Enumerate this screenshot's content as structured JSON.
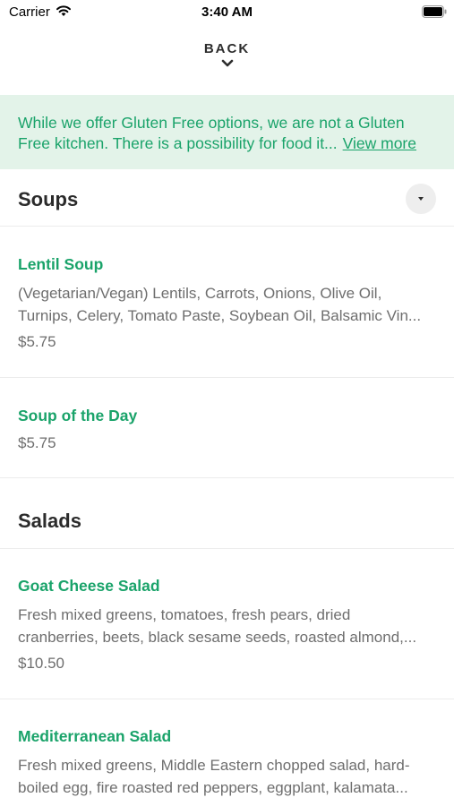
{
  "status_bar": {
    "carrier": "Carrier",
    "time": "3:40 AM"
  },
  "nav": {
    "back_label": "BACK"
  },
  "notice": {
    "text": "While we offer Gluten Free options, we are not a Gluten Free kitchen. There is a possibility for food it...",
    "link": "View more"
  },
  "sections": [
    {
      "title": "Soups",
      "items": [
        {
          "name": "Lentil Soup",
          "desc_line1": "(Vegetarian/Vegan)  Lentils, Carrots, Onions, Olive Oil,",
          "desc_line2": "Turnips, Celery, Tomato Paste, Soybean Oil, Balsamic Vin...",
          "price": "$5.75"
        },
        {
          "name": "Soup of the Day",
          "price": "$5.75"
        }
      ]
    },
    {
      "title": "Salads",
      "items": [
        {
          "name": "Goat Cheese Salad",
          "desc_line1": "Fresh mixed greens, tomatoes, fresh pears, dried",
          "desc_line2": "cranberries, beets, black sesame seeds, roasted almond,...",
          "price": "$10.50"
        },
        {
          "name": "Mediterranean Salad",
          "desc_line1": "Fresh mixed greens, Middle Eastern chopped salad, hard-",
          "desc_line2": "boiled egg, fire roasted red peppers, eggplant, kalamata..."
        }
      ]
    }
  ],
  "colors": {
    "accent": "#1aa36a",
    "notice_bg": "#e3f3e9"
  },
  "icons": {
    "wifi": "wifi-icon",
    "battery": "battery-icon",
    "back_chevron": "chevron-down-icon",
    "section_dropdown": "caret-down-icon"
  }
}
